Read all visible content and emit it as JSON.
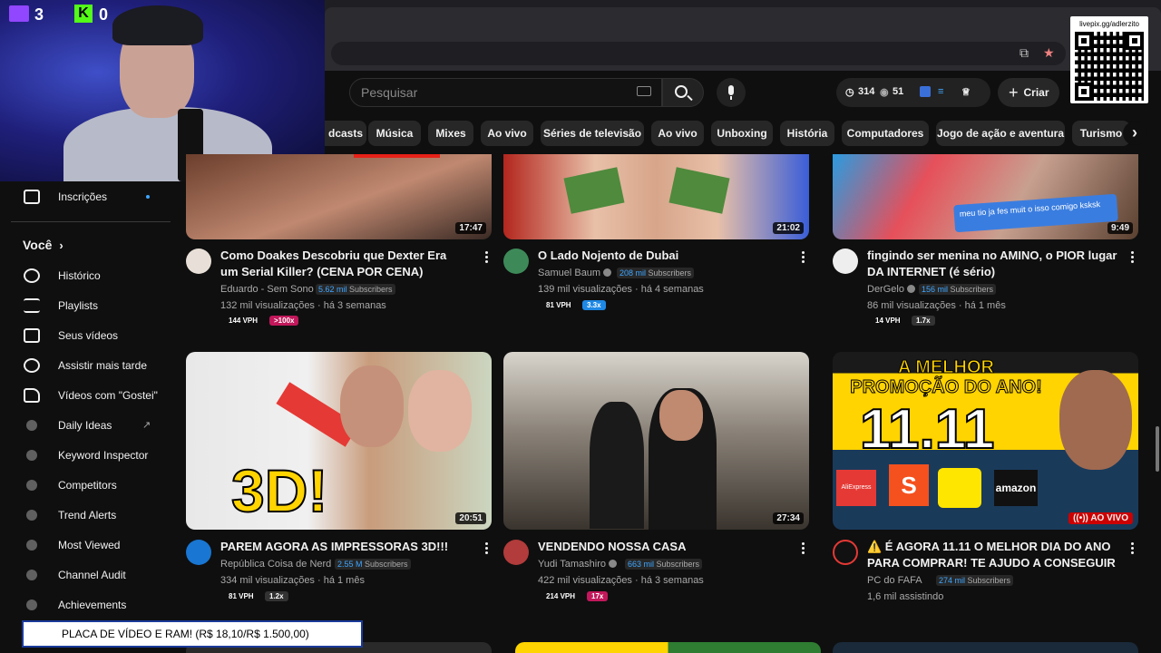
{
  "browser": {
    "icons": [
      "install-icon",
      "star-icon"
    ]
  },
  "header": {
    "search_placeholder": "Pesquisar",
    "stats": {
      "clock_value": "314",
      "eye_value": "51"
    },
    "create_label": "Criar"
  },
  "qr": {
    "label": "livepix.gg/adlerzito"
  },
  "webcam": {
    "twitch_count": "3",
    "kick_count": "0",
    "kick_letter": "K"
  },
  "chips": [
    "dcasts",
    "Música",
    "Mixes",
    "Ao vivo",
    "Séries de televisão",
    "Ao vivo",
    "Unboxing",
    "História",
    "Computadores",
    "Jogo de ação e aventura",
    "Turismo"
  ],
  "chip_next": "›",
  "sidebar": {
    "subscriptions": "Inscrições",
    "voce": "Você",
    "voce_chevron": "›",
    "items": [
      "Histórico",
      "Playlists",
      "Seus vídeos",
      "Assistir mais tarde",
      "Vídeos com \"Gostei\"",
      "Daily Ideas",
      "Keyword Inspector",
      "Competitors",
      "Trend Alerts",
      "Most Viewed",
      "Channel Audit",
      "Achievements"
    ],
    "external_icon": "↗"
  },
  "videos": [
    {
      "duration": "17:47",
      "title": "Como Doakes Descobriu que Dexter Era um Serial Killer? (CENA POR CENA)",
      "channel": "Eduardo - Sem Sono",
      "subs_num": "5.62 mil",
      "subs_word": "Subscribers",
      "meta": "132 mil visualizações · há 3 semanas",
      "vph": "144 VPH",
      "ratio": ">100x",
      "ratio_color": "#c2185b"
    },
    {
      "duration": "21:02",
      "title": "O Lado Nojento de Dubai",
      "channel": "Samuel Baum",
      "subs_num": "208 mil",
      "subs_word": "Subscribers",
      "meta": "139 mil visualizações · há 4 semanas",
      "vph": "81 VPH",
      "ratio": "3.3x",
      "ratio_color": "#1e88e5"
    },
    {
      "duration": "9:49",
      "overlay": "meu tio ja fes muit o isso comigo ksksk",
      "title": "fingindo ser menina no AMINO, o PIOR lugar DA INTERNET (é sério)",
      "channel": "DerGelo",
      "subs_num": "156 mil",
      "subs_word": "Subscribers",
      "meta": "86 mil visualizações · há 1 mês",
      "vph": "14 VPH",
      "ratio": "1.7x",
      "ratio_color": "#333333"
    },
    {
      "duration": "20:51",
      "thumb_text": "3D!",
      "title": "PAREM AGORA AS IMPRESSORAS 3D!!!",
      "channel": "República Coisa de Nerd",
      "subs_num": "2.55 M",
      "subs_word": "Subscribers",
      "meta": "334 mil visualizações · há 1 mês",
      "vph": "81 VPH",
      "ratio": "1.2x",
      "ratio_color": "#333333"
    },
    {
      "duration": "27:34",
      "title": "VENDENDO NOSSA CASA",
      "channel": "Yudi Tamashiro",
      "subs_num": "663 mil",
      "subs_word": "Subscribers",
      "meta": "422 mil visualizações · há 3 semanas",
      "vph": "214 VPH",
      "ratio": "17x",
      "ratio_color": "#c2185b"
    },
    {
      "live": "AO VIVO",
      "thumb_line1": "A MELHOR",
      "thumb_line2": "PROMOÇÃO DO ANO!",
      "thumb_big": "11.11",
      "thumb_brand1": "AliExpress",
      "thumb_brand2": "S",
      "thumb_brand3": "amazon",
      "title": "⚠️ É AGORA 11.11 O MELHOR DIA DO ANO PARA COMPRAR! TE AJUDO A CONSEGUIR OS ...",
      "channel": "PC do FAFA",
      "subs_num": "274 mil",
      "subs_word": "Subscribers",
      "meta": "1,6 mil assistindo"
    }
  ],
  "ticker": "PLACA DE VÍDEO E RAM! (R$ 18,10/R$ 1.500,00)"
}
